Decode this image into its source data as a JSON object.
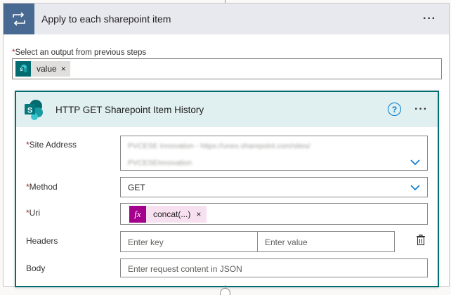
{
  "loop": {
    "title": "Apply to each sharepoint item",
    "menu": "···",
    "select_label": "Select an output from previous steps",
    "required_mark": "*",
    "token_label": "value",
    "token_remove": "×"
  },
  "action": {
    "title": "HTTP GET Sharepoint Item History",
    "help": "?",
    "menu": "···",
    "site_address": {
      "label": "Site Address",
      "value_line1": "PVCESE Innovation - https://unex.sharepoint.com/sites/",
      "value_line2": "PVCESEInnovation"
    },
    "method": {
      "label": "Method",
      "value": "GET"
    },
    "uri": {
      "label": "Uri",
      "token": "concat(...)",
      "token_remove": "×",
      "fx": "fx"
    },
    "headers": {
      "label": "Headers",
      "key_placeholder": "Enter key",
      "value_placeholder": "Enter value"
    },
    "body": {
      "label": "Body",
      "placeholder": "Enter request content in JSON"
    }
  },
  "colors": {
    "loop_tile": "#486991",
    "sharepoint": "#036c70",
    "expression": "#a4008b",
    "accent_blue": "#0078d4",
    "required": "#a4262c"
  },
  "icons": [
    "loop-icon",
    "sharepoint-icon",
    "help-icon",
    "chevron-down-icon",
    "fx-icon",
    "delete-icon"
  ]
}
